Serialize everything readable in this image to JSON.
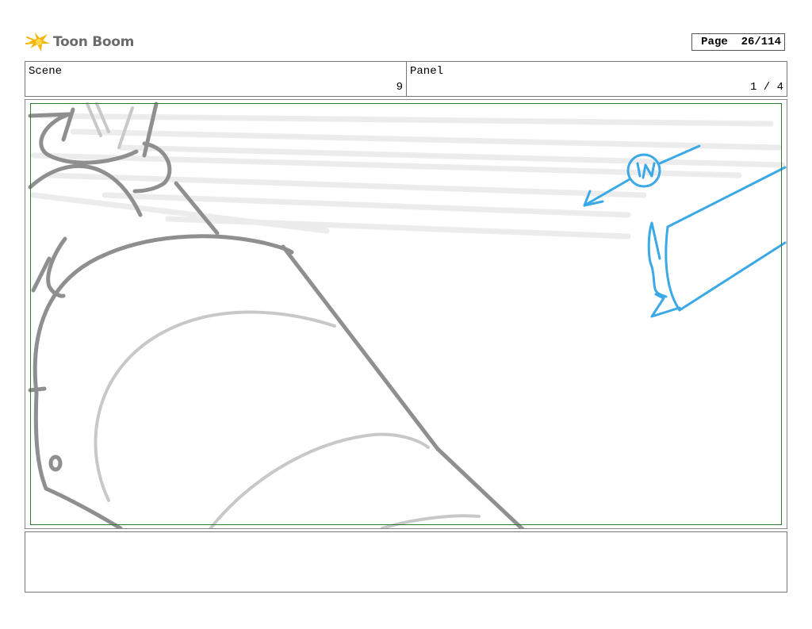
{
  "header": {
    "logo_text": "Toon Boom",
    "page_label": "Page",
    "page_value": "26/114"
  },
  "info": {
    "scene_label": "Scene",
    "scene_value": "9",
    "panel_label": "Panel",
    "panel_value": "1 / 4"
  },
  "panel": {
    "sketch_annotation": "IN",
    "sketch_color_primary": "#8f8f8f",
    "sketch_color_secondary": "#c8c8c8",
    "annotation_color": "#3aa9e6",
    "safe_area_color": "#2e7d32"
  },
  "notes": {
    "text": ""
  }
}
